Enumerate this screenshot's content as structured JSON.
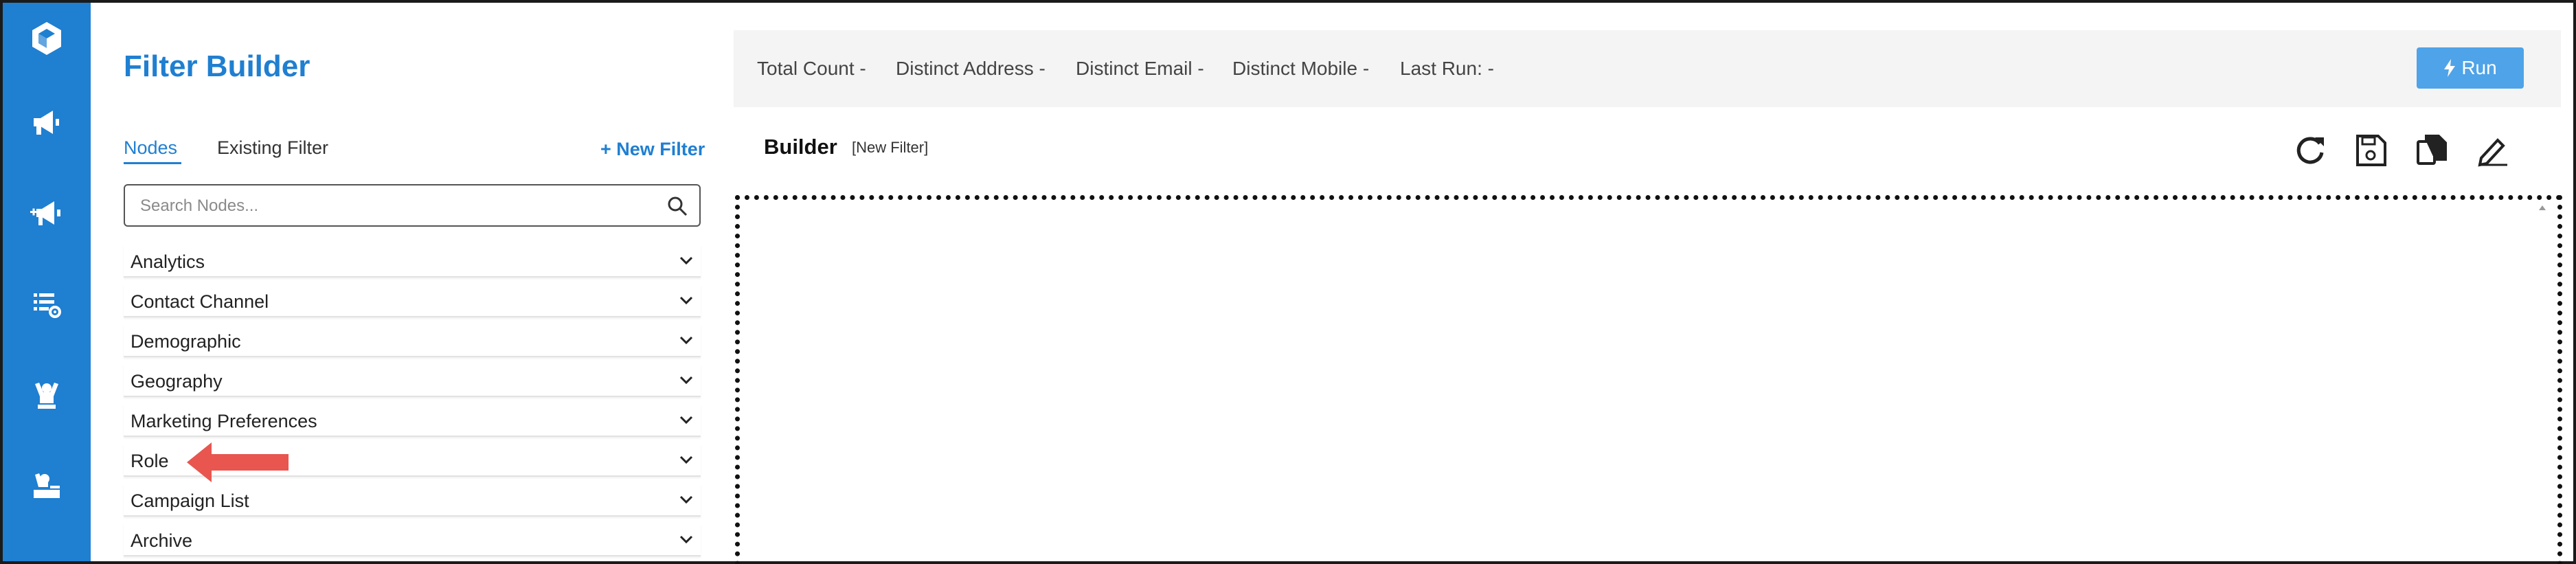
{
  "app": {
    "title": "Filter Builder"
  },
  "rail": {
    "icons": [
      "logo-icon",
      "megaphone-icon",
      "megaphone-add-icon",
      "list-settings-icon",
      "person-raised-icon",
      "person-desk-icon"
    ]
  },
  "tabs": [
    {
      "label": "Nodes",
      "active": true
    },
    {
      "label": "Existing Filter",
      "active": false
    }
  ],
  "new_filter_label": "+ New Filter",
  "search": {
    "placeholder": "Search Nodes...",
    "value": ""
  },
  "nodes": [
    {
      "label": "Analytics"
    },
    {
      "label": "Contact Channel"
    },
    {
      "label": "Demographic"
    },
    {
      "label": "Geography"
    },
    {
      "label": "Marketing Preferences"
    },
    {
      "label": "Role"
    },
    {
      "label": "Campaign List"
    },
    {
      "label": "Archive"
    }
  ],
  "stats": {
    "total_count": "Total Count  -",
    "distinct_address": "Distinct Address  -",
    "distinct_email": "Distinct Email  -",
    "distinct_mobile": "Distinct Mobile  -",
    "last_run": "Last Run:  -"
  },
  "run_label": "Run",
  "builder": {
    "title": "Builder",
    "subtitle": "[New Filter]"
  },
  "toolbar": [
    "refresh-icon",
    "save-icon",
    "copy-icon",
    "edit-icon"
  ],
  "colors": {
    "brand": "#1f7fd1",
    "run_button": "#4fa3e8",
    "annotation_arrow": "#e8564f"
  }
}
